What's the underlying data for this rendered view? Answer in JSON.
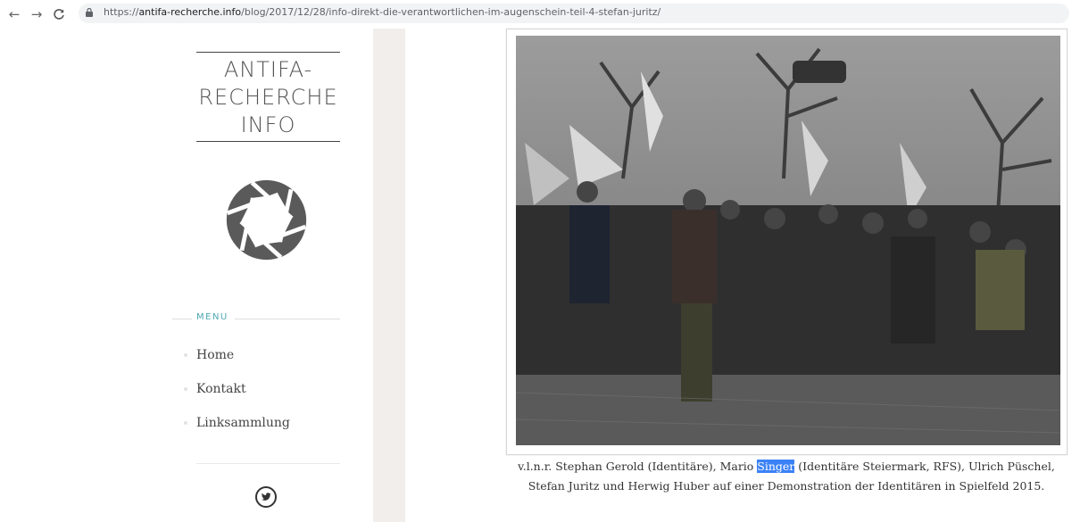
{
  "browser": {
    "url_prefix": "https://",
    "url_host": "antifa-recherche.info",
    "url_path": "/blog/2017/12/28/info-direkt-die-verantwortlichen-im-augenschein-teil-4-stefan-juritz/"
  },
  "sidebar": {
    "site_title": "ANTIFA-\nRECHERCHE\nINFO",
    "menu_heading": "MENU",
    "menu_items": [
      {
        "label": "Home"
      },
      {
        "label": "Kontakt"
      },
      {
        "label": "Linksammlung"
      }
    ]
  },
  "figure": {
    "caption_before": "v.l.n.r. Stephan Gerold (Identitäre), Mario ",
    "caption_highlight": "Singer",
    "caption_after": " (Identitäre Steiermark, RFS), Ulrich Püschel, Stefan Juritz und Herwig Huber auf einer Demonstration der Identitären in Spielfeld 2015."
  },
  "colors": {
    "accent": "#4ea7b3",
    "gutter": "#f1eeeb",
    "selection": "#3b82f6"
  },
  "icons": [
    "back-arrow-icon",
    "forward-arrow-icon",
    "reload-icon",
    "lock-icon",
    "aperture-logo-icon",
    "twitter-icon"
  ]
}
